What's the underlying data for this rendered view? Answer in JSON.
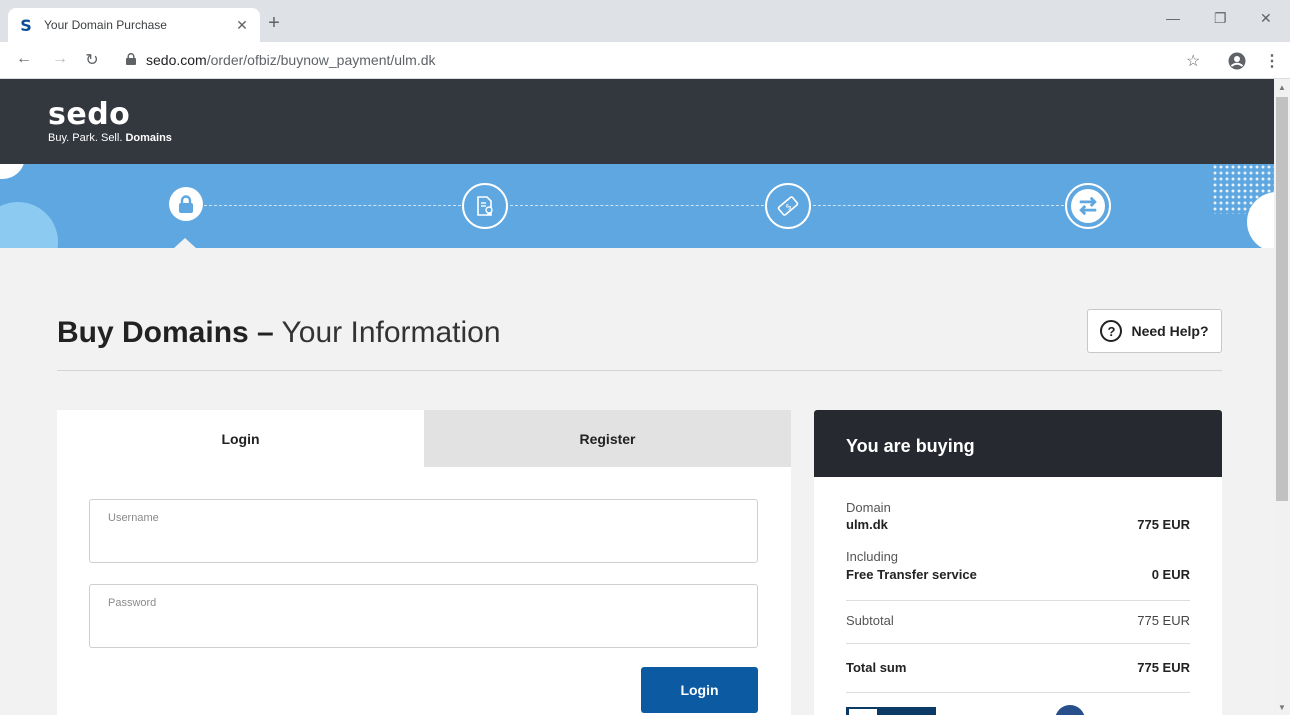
{
  "browser": {
    "tab_title": "Your Domain Purchase",
    "favicon_letter": "S",
    "url_host": "sedo.com",
    "url_path": "/order/ofbiz/buynow_payment/ulm.dk"
  },
  "header": {
    "logo": "sedo",
    "tagline_plain": "Buy. Park. Sell.",
    "tagline_bold": "Domains"
  },
  "steps": [
    {
      "icon": "lock-icon"
    },
    {
      "icon": "certificate-icon"
    },
    {
      "icon": "payment-ticket-icon"
    },
    {
      "icon": "transfer-arrows-icon"
    }
  ],
  "page": {
    "heading_bold": "Buy Domains –",
    "heading_light": "Your Information",
    "help_label": "Need Help?"
  },
  "auth": {
    "tab_login": "Login",
    "tab_register": "Register",
    "username_label": "Username",
    "password_label": "Password",
    "login_button": "Login"
  },
  "summary": {
    "title": "You are buying",
    "domain_label": "Domain",
    "domain_name": "ulm.dk",
    "domain_price": "775 EUR",
    "including_label": "Including",
    "service_name": "Free Transfer service",
    "service_price": "0 EUR",
    "subtotal_label": "Subtotal",
    "subtotal_value": "775 EUR",
    "total_label": "Total sum",
    "total_value": "775 EUR"
  },
  "colors": {
    "header_bg": "#33373e",
    "steps_bg": "#5fa7e0",
    "primary_button": "#0b5aa2",
    "summary_head_bg": "#262a30"
  }
}
